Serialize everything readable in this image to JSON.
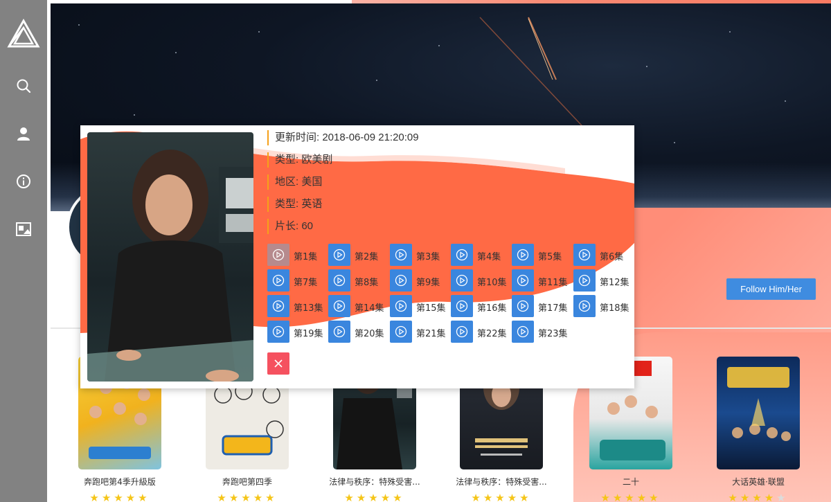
{
  "sidebar": {
    "icons": [
      "logo-triangle-icon",
      "search-icon",
      "user-icon",
      "info-icon",
      "image-icon"
    ]
  },
  "profile": {
    "follow_label": "Follow Him/Her"
  },
  "modal": {
    "meta": [
      {
        "label": "更新时间: 2018-06-09 21:20:09"
      },
      {
        "label": "类型: 欧美剧"
      },
      {
        "label": "地区: 美国"
      },
      {
        "label": "类型: 英语"
      },
      {
        "label": "片长: 60"
      }
    ],
    "episodes": [
      "第1集",
      "第2集",
      "第3集",
      "第4集",
      "第5集",
      "第6集",
      "第7集",
      "第8集",
      "第9集",
      "第10集",
      "第11集",
      "第12集",
      "第13集",
      "第14集",
      "第15集",
      "第16集",
      "第17集",
      "第18集",
      "第19集",
      "第20集",
      "第21集",
      "第22集",
      "第23集"
    ],
    "active_episode": 0,
    "close_icon": "close-icon"
  },
  "cards": [
    {
      "title": "奔跑吧第4季升級版",
      "rating": 5
    },
    {
      "title": "奔跑吧第四季",
      "rating": 5
    },
    {
      "title": "法律与秩序：特殊受害...",
      "rating": 5
    },
    {
      "title": "法律与秩序：特殊受害...",
      "rating": 5
    },
    {
      "title": "二十",
      "rating": 5
    },
    {
      "title": "大话英雄·联盟",
      "rating": 4
    }
  ],
  "colors": {
    "accent_blue": "#3f8ce0",
    "coral": "#ff6a45",
    "meta_bar": "#f5a11a",
    "close_red": "#f5515f"
  }
}
